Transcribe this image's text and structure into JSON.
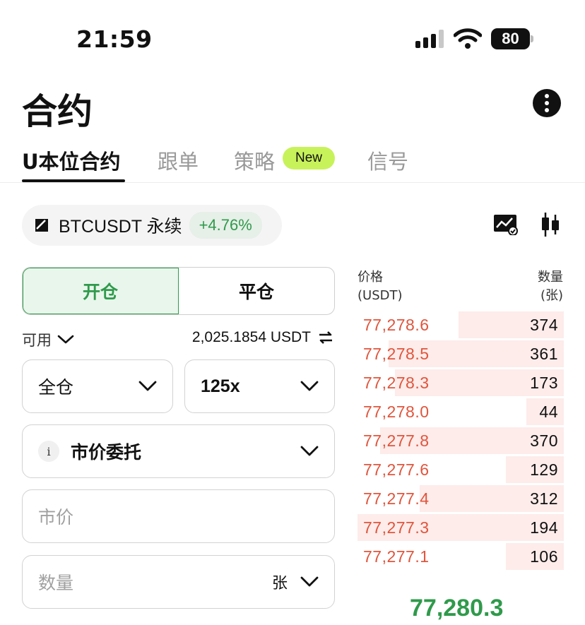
{
  "status": {
    "time": "21:59",
    "battery": "80"
  },
  "header": {
    "title": "合约"
  },
  "tabs": [
    {
      "label": "U本位合约"
    },
    {
      "label": "跟单"
    },
    {
      "label": "策略"
    },
    {
      "label": "信号"
    }
  ],
  "new_badge": "New",
  "symbol": {
    "name": "BTCUSDT 永续",
    "change": "+4.76%"
  },
  "toggle": {
    "open": "开仓",
    "close": "平仓"
  },
  "available": {
    "label": "可用",
    "value": "2,025.1854 USDT"
  },
  "margin_mode": "全仓",
  "leverage": "125x",
  "order_type": {
    "info": "i",
    "label": "市价委托"
  },
  "price_field": {
    "placeholder": "市价"
  },
  "qty_field": {
    "placeholder": "数量",
    "unit": "张"
  },
  "orderbook": {
    "price_header": "价格",
    "price_unit": "(USDT)",
    "qty_header": "数量",
    "qty_unit": "(张)",
    "asks": [
      {
        "price": "77,278.6",
        "qty": "374",
        "depth": 0.51
      },
      {
        "price": "77,278.5",
        "qty": "361",
        "depth": 0.85
      },
      {
        "price": "77,278.3",
        "qty": "173",
        "depth": 0.82
      },
      {
        "price": "77,278.0",
        "qty": "44",
        "depth": 0.18
      },
      {
        "price": "77,277.8",
        "qty": "370",
        "depth": 0.89
      },
      {
        "price": "77,277.6",
        "qty": "129",
        "depth": 0.28
      },
      {
        "price": "77,277.4",
        "qty": "312",
        "depth": 0.7
      },
      {
        "price": "77,277.3",
        "qty": "194",
        "depth": 1.0
      },
      {
        "price": "77,277.1",
        "qty": "106",
        "depth": 0.28
      }
    ],
    "last_price": "77,280.3"
  },
  "colors": {
    "green": "#2f9a4b",
    "red": "#e0553c",
    "badge": "#c8f25a"
  }
}
